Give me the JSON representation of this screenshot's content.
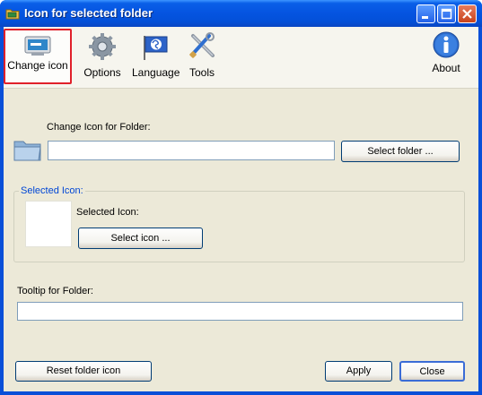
{
  "window": {
    "title": "Icon for selected folder"
  },
  "toolbar": {
    "change_icon": "Change icon",
    "options": "Options",
    "language": "Language",
    "tools": "Tools",
    "about": "About"
  },
  "folder_section": {
    "label": "Change Icon for Folder:",
    "value": "",
    "select_button": "Select folder ..."
  },
  "selected_icon_group": {
    "title": "Selected Icon:",
    "label": "Selected Icon:",
    "select_button": "Select icon ..."
  },
  "tooltip_section": {
    "label": "Tooltip for Folder:",
    "value": ""
  },
  "footer": {
    "reset_button": "Reset folder icon",
    "apply_button": "Apply",
    "close_button": "Close"
  },
  "colors": {
    "titlebar": "#0554e0",
    "dialog_bg": "#ece9d8",
    "selected_tool_border": "#e0202a",
    "group_title": "#0046d5"
  }
}
